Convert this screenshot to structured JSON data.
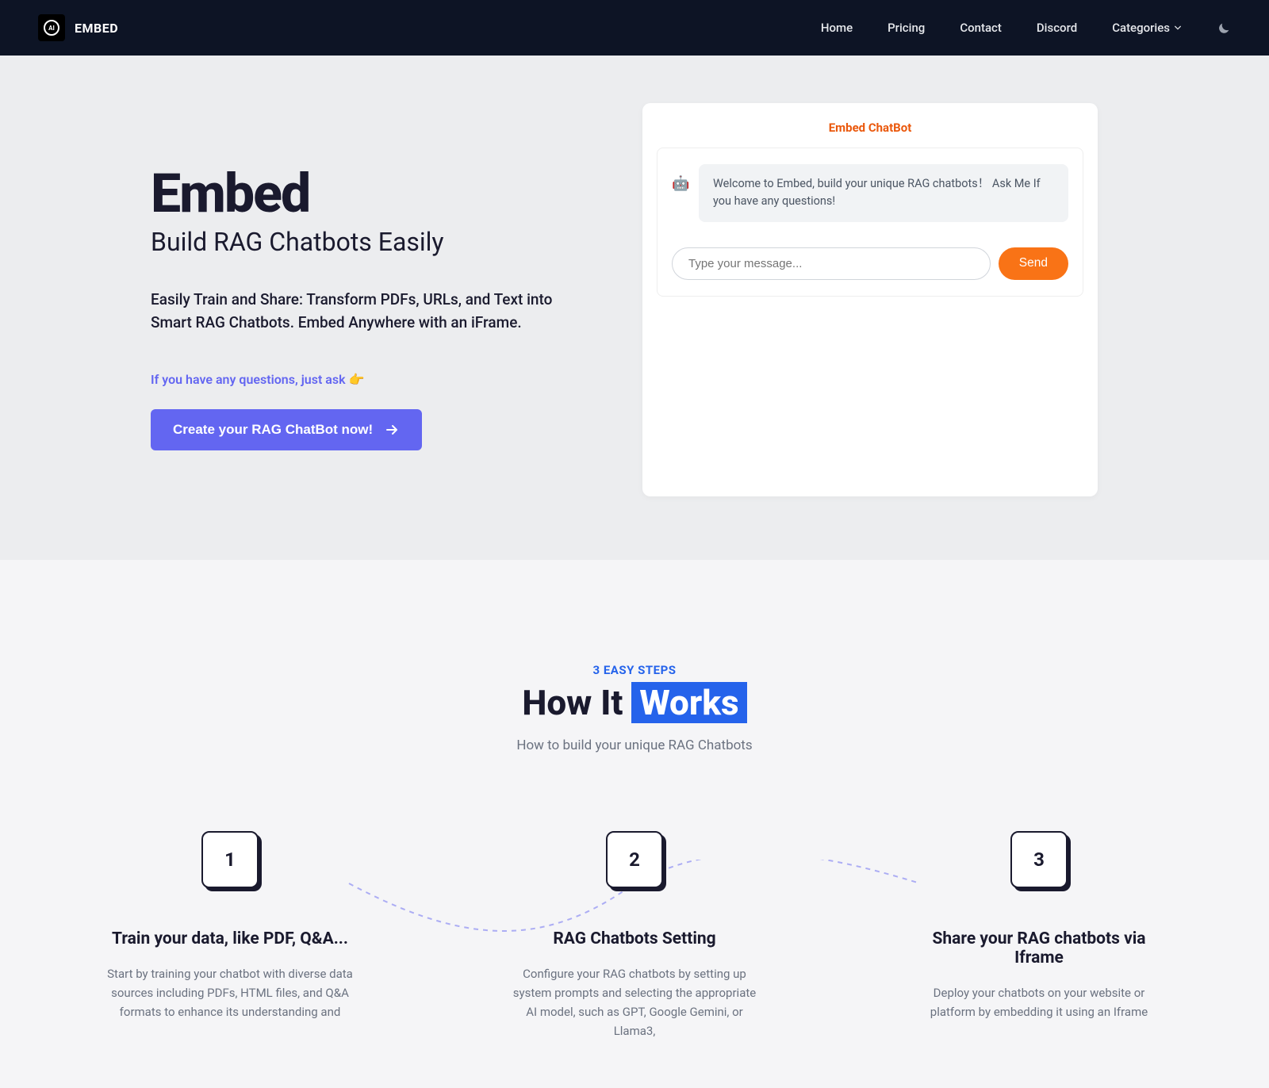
{
  "nav": {
    "logoText": "EMBED",
    "links": [
      "Home",
      "Pricing",
      "Contact",
      "Discord",
      "Categories"
    ]
  },
  "hero": {
    "title": "Embed",
    "subtitle": "Build RAG Chatbots Easily",
    "description": "Easily Train and Share: Transform PDFs, URLs, and Text into Smart RAG Chatbots. Embed Anywhere with an iFrame.",
    "hint": "If you have any questions, just ask 👉",
    "cta": "Create your RAG ChatBot now!"
  },
  "chatbot": {
    "title": "Embed ChatBot",
    "welcome": "Welcome to Embed, build your unique RAG chatbots！ Ask Me If you have any questions!",
    "placeholder": "Type your message...",
    "send": "Send"
  },
  "how": {
    "badge": "3 EASY STEPS",
    "titlePrefix": "How It ",
    "titleHighlight": "Works",
    "sub": "How to build your unique RAG Chatbots",
    "steps": [
      {
        "num": "1",
        "title": "Train your data, like PDF, Q&A...",
        "desc": "Start by training your chatbot with diverse data sources including PDFs, HTML files, and Q&A formats to enhance its understanding and"
      },
      {
        "num": "2",
        "title": "RAG Chatbots Setting",
        "desc": "Configure your RAG chatbots by setting up system prompts and selecting the appropriate AI model, such as GPT, Google Gemini, or Llama3,"
      },
      {
        "num": "3",
        "title": "Share your RAG chatbots via Iframe",
        "desc": "Deploy your chatbots on your website or platform by embedding it using an Iframe"
      }
    ]
  }
}
